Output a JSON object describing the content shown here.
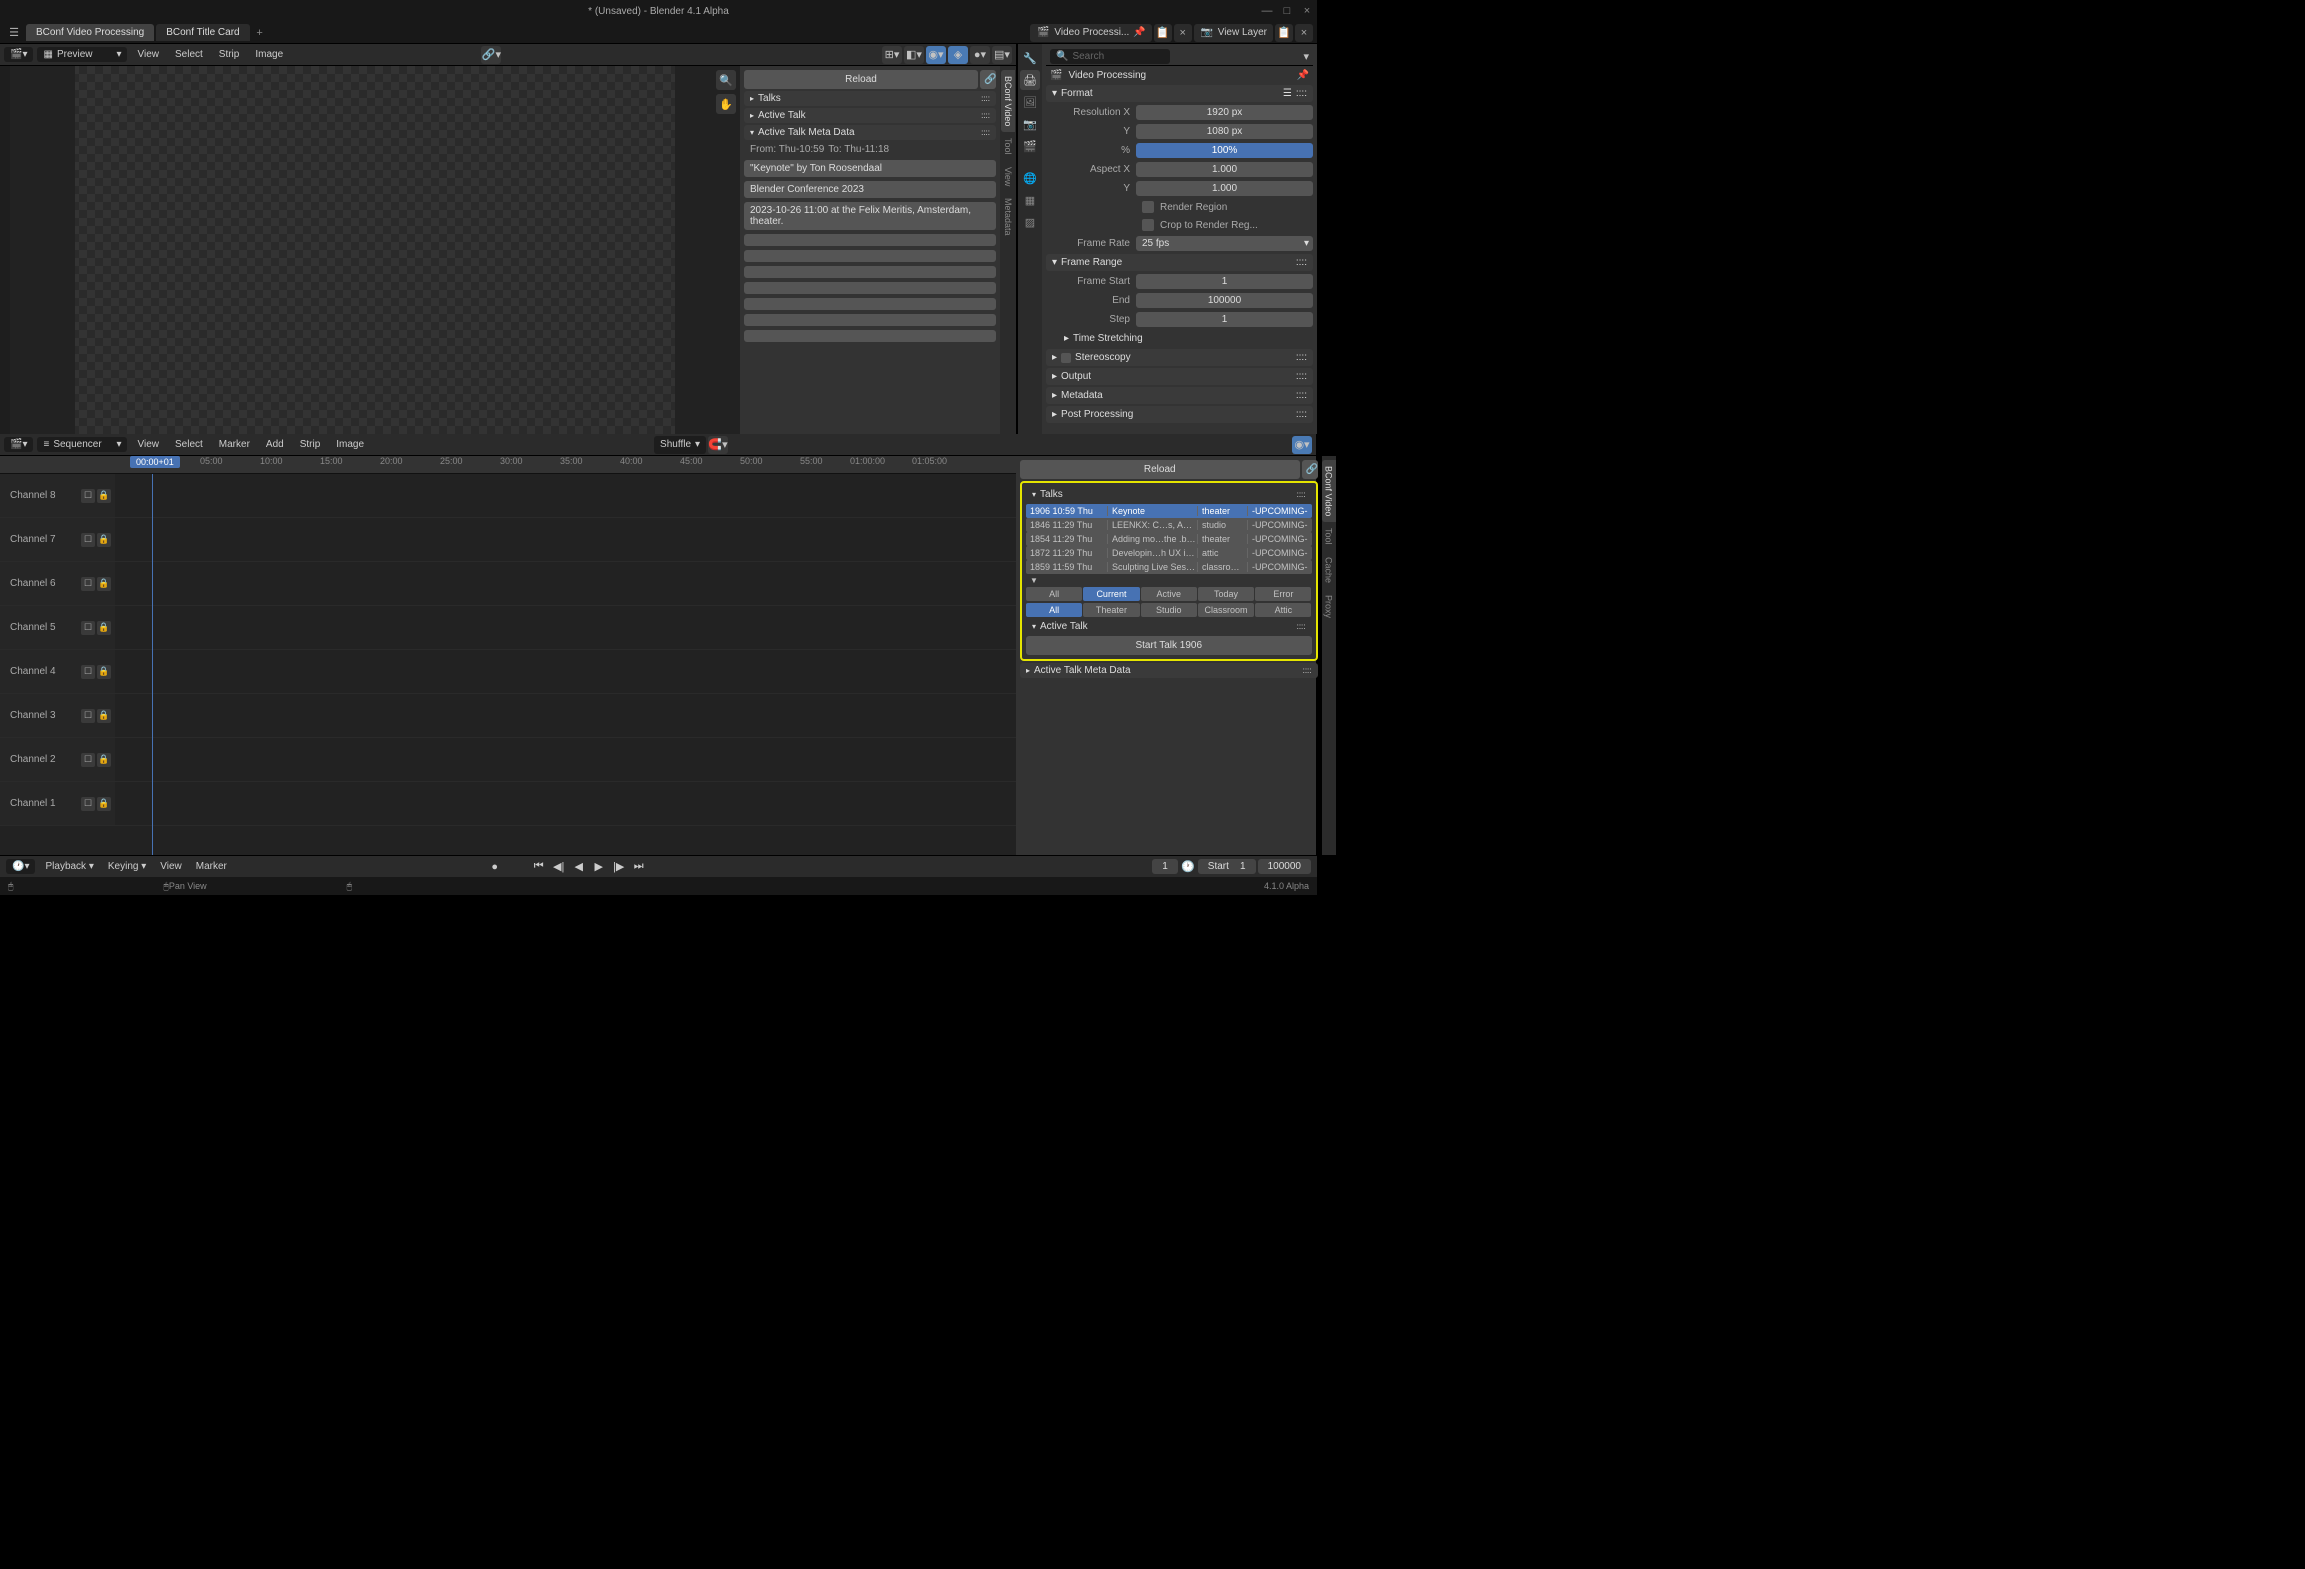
{
  "titlebar": {
    "title": "* (Unsaved) - Blender 4.1 Alpha"
  },
  "workspace": {
    "tabs": [
      {
        "label": "BConf Video Processing",
        "active": true
      },
      {
        "label": "BConf Title Card",
        "active": false
      }
    ],
    "scene": "Video Processi...",
    "view_layer": "View Layer"
  },
  "preview": {
    "mode": "Preview",
    "menus": [
      "View",
      "Select",
      "Strip",
      "Image"
    ]
  },
  "side_panel_top": {
    "reload": "Reload",
    "sections": {
      "talks": "Talks",
      "active_talk": "Active Talk",
      "meta_data": "Active Talk Meta Data"
    },
    "from": "From: Thu-10:59",
    "to": "To: Thu-11:18",
    "fields": [
      "\"Keynote\" by Ton Roosendaal",
      "Blender Conference 2023",
      "2023-10-26 11:00 at the Felix Meritis, Amsterdam, theater."
    ],
    "vtabs": [
      "BConf Video",
      "Tool",
      "View",
      "Metadata"
    ]
  },
  "props": {
    "title": "Video Processing",
    "search_placeholder": "Search",
    "format": {
      "label": "Format",
      "res_x_lbl": "Resolution X",
      "res_x": "1920 px",
      "res_y_lbl": "Y",
      "res_y": "1080 px",
      "pct_lbl": "%",
      "pct": "100%",
      "aspect_x_lbl": "Aspect X",
      "aspect_x": "1.000",
      "aspect_y_lbl": "Y",
      "aspect_y": "1.000",
      "render_region": "Render Region",
      "crop": "Crop to Render Reg...",
      "frame_rate_lbl": "Frame Rate",
      "frame_rate": "25 fps"
    },
    "frame_range": {
      "label": "Frame Range",
      "start_lbl": "Frame Start",
      "start": "1",
      "end_lbl": "End",
      "end": "100000",
      "step_lbl": "Step",
      "step": "1",
      "time_stretch": "Time Stretching"
    },
    "sections": [
      "Stereoscopy",
      "Output",
      "Metadata",
      "Post Processing"
    ]
  },
  "sequencer": {
    "mode": "Sequencer",
    "menus": [
      "View",
      "Select",
      "Marker",
      "Add",
      "Strip",
      "Image"
    ],
    "overlap": "Shuffle",
    "playhead": "00:00+01",
    "ruler": [
      "05:00",
      "10:00",
      "15:00",
      "20:00",
      "25:00",
      "30:00",
      "35:00",
      "40:00",
      "45:00",
      "50:00",
      "55:00",
      "01:00:00",
      "01:05:00"
    ],
    "channels": [
      "Channel 8",
      "Channel 7",
      "Channel 6",
      "Channel 5",
      "Channel 4",
      "Channel 3",
      "Channel 2",
      "Channel 1"
    ],
    "side": {
      "reload": "Reload",
      "talks_label": "Talks",
      "talks": [
        {
          "t": "1906 10:59 Thu",
          "n": "Keynote",
          "r": "theater",
          "s": "-UPCOMING-",
          "sel": true
        },
        {
          "t": "1846 11:29 Thu",
          "n": "LEENKX: C…s, Apps, A.I.",
          "r": "studio",
          "s": "-UPCOMING-"
        },
        {
          "t": "1854 11:29 Thu",
          "n": "Adding mo…the .blend…",
          "r": "theater",
          "s": "-UPCOMING-"
        },
        {
          "t": "1872 11:29 Thu",
          "n": "Developin…h UX in mind",
          "r": "attic",
          "s": "-UPCOMING-"
        },
        {
          "t": "1859 11:59 Thu",
          "n": "Sculpting Live Session",
          "r": "classro…",
          "s": "-UPCOMING-"
        }
      ],
      "filter1": [
        "All",
        "Current",
        "Active",
        "Today",
        "Error"
      ],
      "filter1_active": "Current",
      "filter2": [
        "All",
        "Theater",
        "Studio",
        "Classroom",
        "Attic"
      ],
      "filter2_active": "All",
      "active_talk": "Active Talk",
      "start_btn": "Start Talk 1906",
      "meta": "Active Talk Meta Data",
      "vtabs": [
        "BConf Video",
        "Tool",
        "Cache",
        "Proxy"
      ]
    }
  },
  "timeline": {
    "menus": [
      "Playback",
      "Keying",
      "View",
      "Marker"
    ],
    "current": "1",
    "start_lbl": "Start",
    "start": "1",
    "end": "100000"
  },
  "status": {
    "hint": "Pan View",
    "version": "4.1.0 Alpha"
  }
}
